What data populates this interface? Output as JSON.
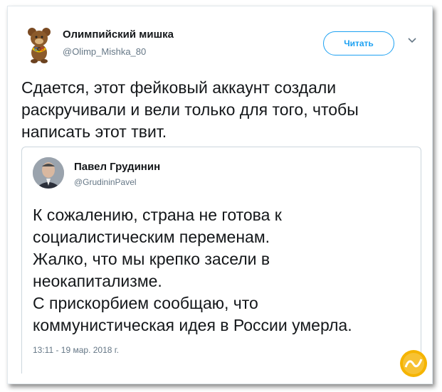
{
  "tweet": {
    "display_name": "Олимпийский мишка",
    "handle": "@Olimp_Mishka_80",
    "follow_label": "Читать",
    "text": "Сдается, этот фейковый аккаунт создали раскручивали и вели только для того, чтобы написать этот твит."
  },
  "quoted": {
    "display_name": "Павел Грудинин",
    "handle": "@GrudininPavel",
    "text": "К сожалению, страна не готова к\nсоциалистическим переменам.\nЖалко, что мы крепко засели в\nнеокапитализме.\nС прискорбием сообщаю, что\nкоммунистическая идея в России умерла.",
    "timestamp": "13:11 - 19 мар. 2018 г."
  },
  "colors": {
    "accent": "#1da1f2",
    "secondary_text": "#657786",
    "border": "#ccd6dd"
  },
  "icons": {
    "avatar": "olympic-bear-icon",
    "menu": "chevron-down-icon",
    "watermark": "logo-icon"
  }
}
